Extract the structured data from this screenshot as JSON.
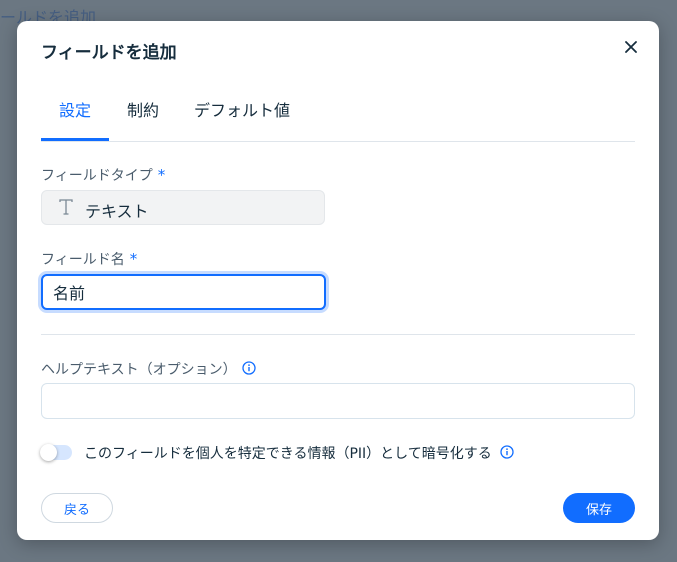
{
  "background": {
    "partial_title": "ールドを追加"
  },
  "dialog": {
    "title": "フィールドを追加",
    "close_icon": "close-icon"
  },
  "tabs": [
    {
      "label": "設定",
      "active": true
    },
    {
      "label": "制約",
      "active": false
    },
    {
      "label": "デフォルト値",
      "active": false
    }
  ],
  "field_type": {
    "label": "フィールドタイプ",
    "required_mark": "*",
    "icon": "text-type-icon",
    "value": "テキスト"
  },
  "field_name": {
    "label": "フィールド名",
    "required_mark": "*",
    "value": "名前"
  },
  "help_text": {
    "label": "ヘルプテキスト（オプション）",
    "value": "",
    "icon": "info-icon"
  },
  "pii": {
    "enabled": false,
    "label": "このフィールドを個人を特定できる情報（PII）として暗号化する",
    "icon": "info-icon"
  },
  "footer": {
    "back_label": "戻る",
    "save_label": "保存"
  },
  "colors": {
    "accent": "#116dff",
    "overlay": "#6b7782",
    "text": "#162d3d"
  }
}
